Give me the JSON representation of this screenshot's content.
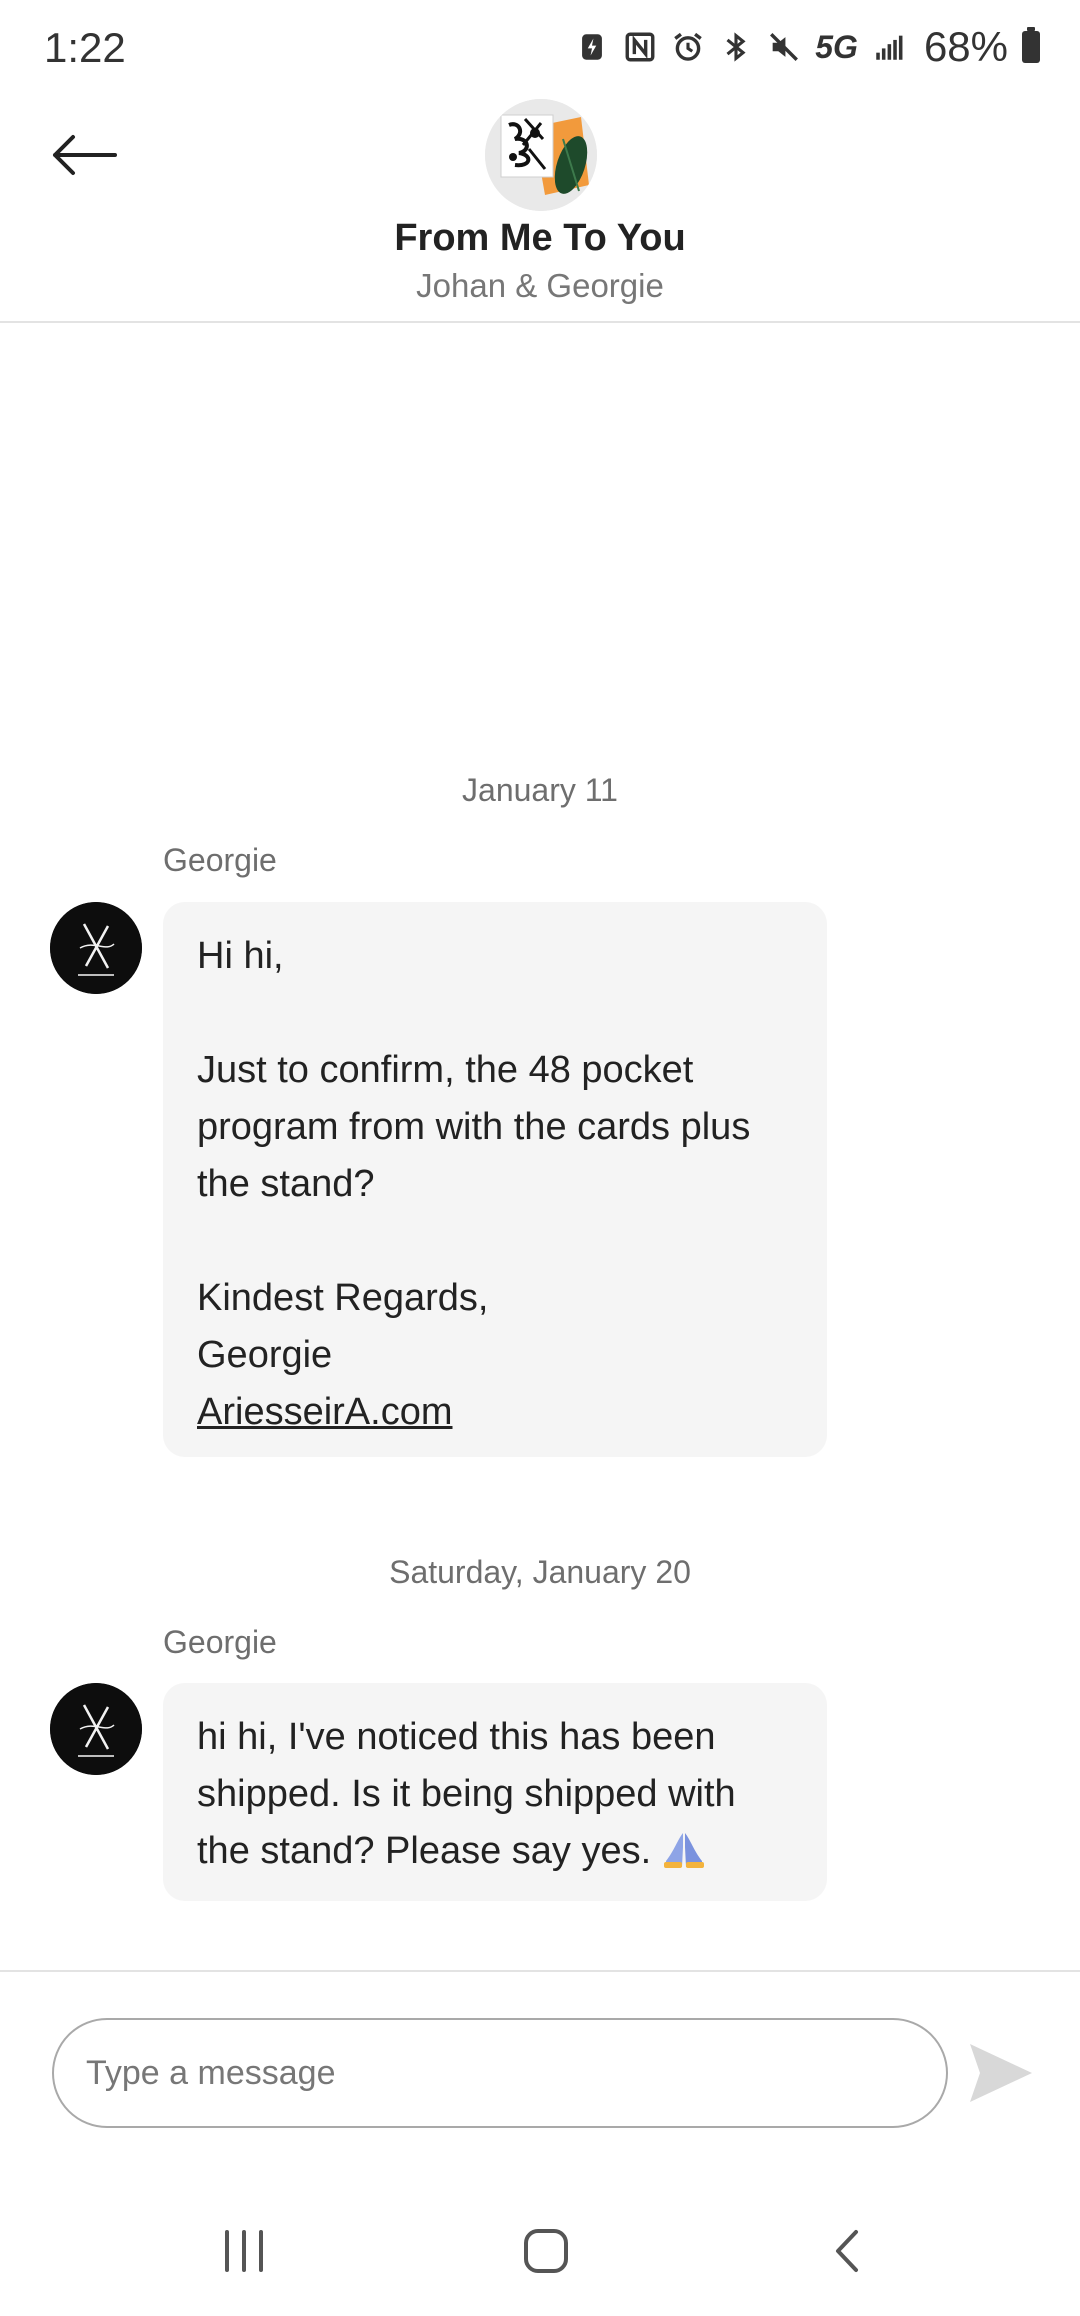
{
  "status_bar": {
    "time": "1:22",
    "network": "5G",
    "battery_percent": "68%",
    "icons": [
      "battery-saver-icon",
      "nfc-icon",
      "alarm-icon",
      "bluetooth-icon",
      "mute-icon",
      "signal-icon",
      "battery-icon"
    ]
  },
  "header": {
    "back_icon": "arrow-left-icon",
    "shop_name": "From Me To You",
    "participants": "Johan & Georgie"
  },
  "conversation": {
    "groups": [
      {
        "date": "January 11",
        "sender": "Georgie",
        "message": {
          "greeting": "Hi hi,",
          "body": "Just to confirm, the 48 pocket program from with the cards plus the stand?",
          "sign_off": "Kindest Regards,",
          "signature": "Georgie",
          "link": "AriesseirA.com"
        }
      },
      {
        "date": "Saturday, January 20",
        "sender": "Georgie",
        "message": {
          "text": "hi hi, I've noticed this has been shipped. Is it being shipped with the stand? Please say yes.",
          "emoji": "folded-hands-icon"
        }
      }
    ]
  },
  "composer": {
    "placeholder": "Type a message",
    "value": "",
    "send_icon": "send-icon"
  },
  "nav_bar": {
    "icons": [
      "recents-icon",
      "home-icon",
      "back-icon"
    ]
  },
  "colors": {
    "bubble_bg": "#f5f5f5",
    "divider": "#e3e3e3",
    "muted_text": "#6e6e6e",
    "send_disabled": "#d8d8d8"
  }
}
